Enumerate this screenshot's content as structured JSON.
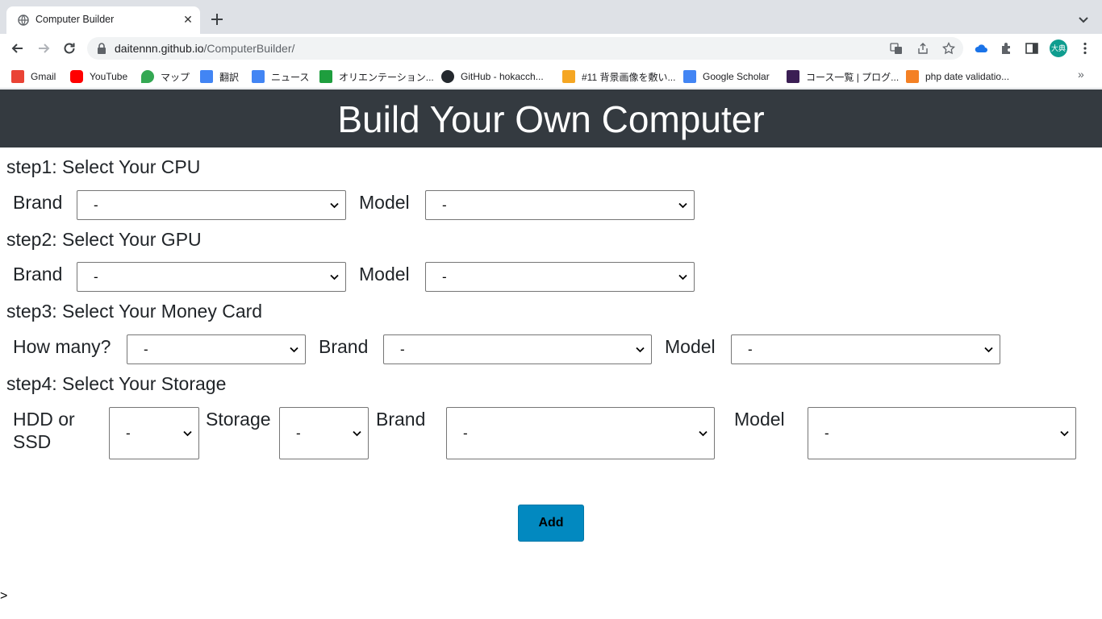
{
  "browser": {
    "tab_title": "Computer Builder",
    "tab_close": "✕",
    "url_host": "daitennn.github.io",
    "url_path": "/ComputerBuilder/",
    "avatar_text": "大典",
    "bookmarks": [
      {
        "label": "Gmail",
        "icon": "gmail-icon",
        "color": "#ea4335"
      },
      {
        "label": "YouTube",
        "icon": "youtube-icon",
        "color": "#ff0000"
      },
      {
        "label": "マップ",
        "icon": "maps-icon",
        "color": "#34a853"
      },
      {
        "label": "翻訳",
        "icon": "translate-icon",
        "color": "#4285f4"
      },
      {
        "label": "ニュース",
        "icon": "news-icon",
        "color": "#4285f4"
      },
      {
        "label": "オリエンテーション...",
        "icon": "orientation-icon",
        "color": "#1e9e3e"
      },
      {
        "label": "GitHub - hokacch...",
        "icon": "github-icon",
        "color": "#24292e"
      },
      {
        "label": "#11 背景画像を敷い...",
        "icon": "box-icon",
        "color": "#f5a623"
      },
      {
        "label": "Google Scholar",
        "icon": "scholar-icon",
        "color": "#4285f4"
      },
      {
        "label": "コース一覧 | プログ...",
        "icon": "progate-icon",
        "color": "#3b1e54"
      },
      {
        "label": "php date validatio...",
        "icon": "stackoverflow-icon",
        "color": "#f48024"
      }
    ],
    "more_bookmarks": "»"
  },
  "page": {
    "title": "Build Your Own Computer",
    "steps": {
      "cpu": {
        "title": "step1: Select Your CPU",
        "brand_label": "Brand",
        "model_label": "Model",
        "brand_value": "-",
        "model_value": "-"
      },
      "gpu": {
        "title": "step2: Select Your GPU",
        "brand_label": "Brand",
        "model_label": "Model",
        "brand_value": "-",
        "model_value": "-"
      },
      "memory": {
        "title": "step3: Select Your Money Card",
        "count_label": "How many?",
        "brand_label": "Brand",
        "model_label": "Model",
        "count_value": "-",
        "brand_value": "-",
        "model_value": "-"
      },
      "storage": {
        "title": "step4: Select Your Storage",
        "type_label": "HDD or SSD",
        "size_label": "Storage",
        "brand_label": "Brand",
        "model_label": "Model",
        "type_value": "-",
        "size_value": "-",
        "brand_value": "-",
        "model_value": "-"
      }
    },
    "add_label": "Add",
    "stray_text": ">"
  }
}
